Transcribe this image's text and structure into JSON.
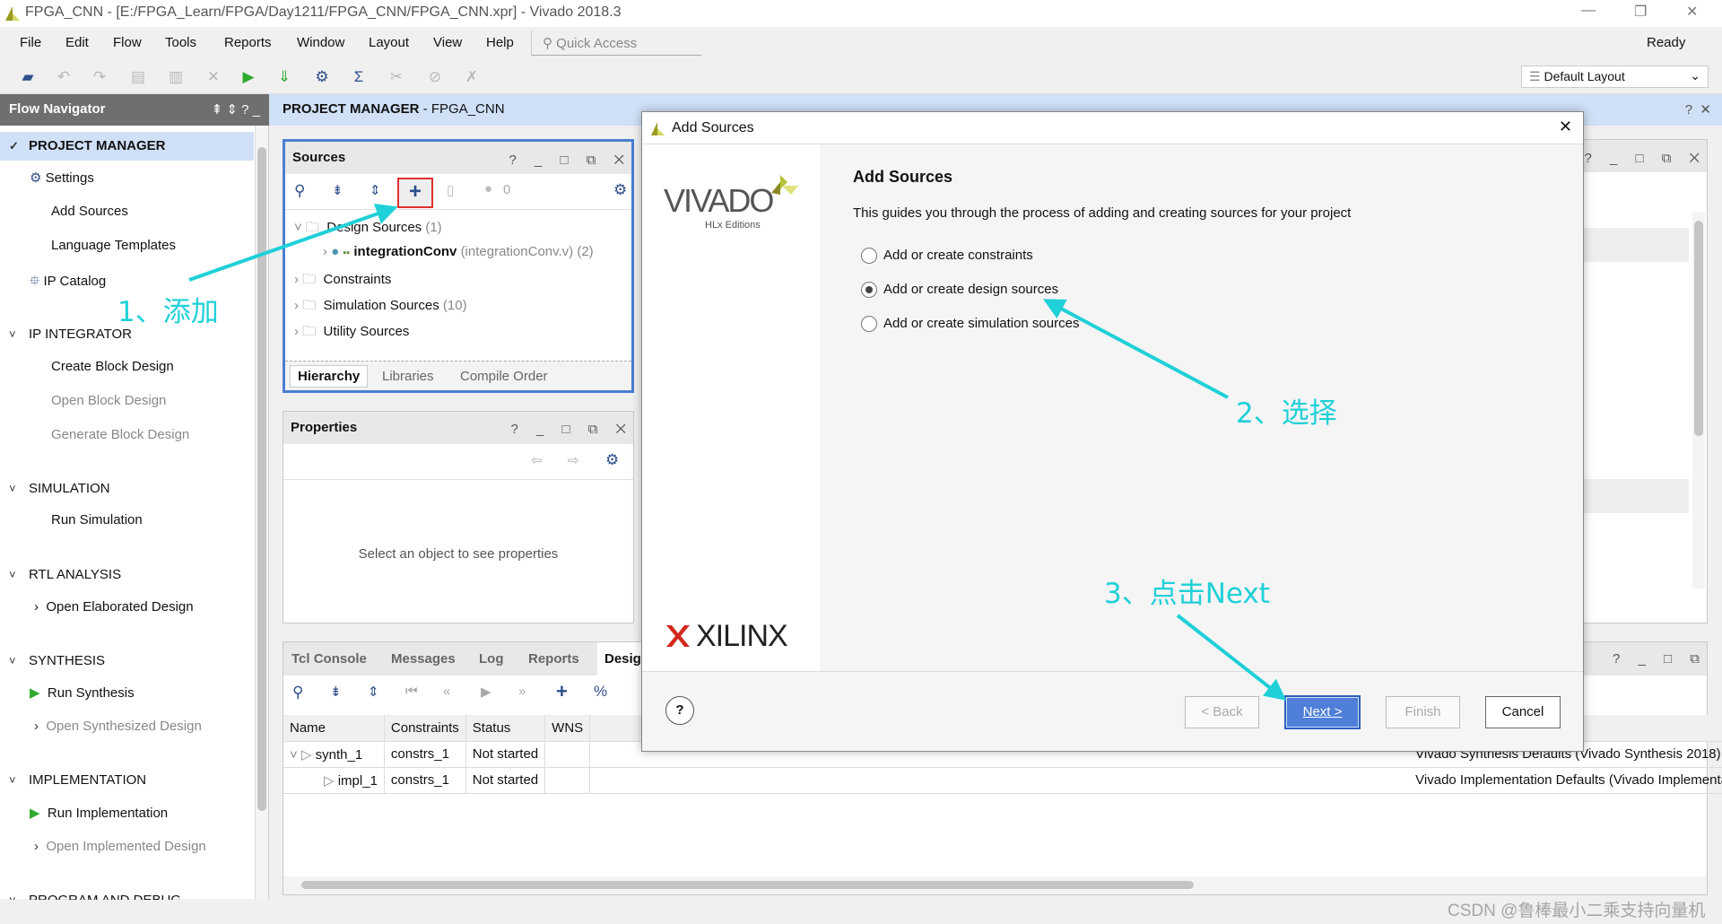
{
  "window": {
    "title": "FPGA_CNN - [E:/FPGA_Learn/FPGA/Day1211/FPGA_CNN/FPGA_CNN.xpr] - Vivado 2018.3",
    "minimize": "—",
    "restore": "❐",
    "close": "✕"
  },
  "menu": [
    "File",
    "Edit",
    "Flow",
    "Tools",
    "Reports",
    "Window",
    "Layout",
    "View",
    "Help"
  ],
  "quick_access": "Quick Access",
  "status": "Ready",
  "layout_select": "Default Layout",
  "toolbar_icons": [
    "open-project-icon",
    "undo-icon",
    "redo-icon",
    "copy-icon",
    "paste-icon",
    "delete-icon",
    "run-icon",
    "program-icon",
    "settings-icon",
    "sigma-icon",
    "cut-icon",
    "disable-icon",
    "x-icon"
  ],
  "flow_nav": {
    "title": "Flow Navigator",
    "controls": "⇞ ⇕ ? _",
    "items": [
      {
        "label": "PROJECT MANAGER",
        "type": "section"
      },
      {
        "label": "Settings",
        "type": "item"
      },
      {
        "label": "Add Sources",
        "type": "item"
      },
      {
        "label": "Language Templates",
        "type": "item"
      },
      {
        "label": "IP Catalog",
        "type": "item"
      },
      {
        "label": "IP INTEGRATOR",
        "type": "section"
      },
      {
        "label": "Create Block Design",
        "type": "item"
      },
      {
        "label": "Open Block Design",
        "type": "disabled"
      },
      {
        "label": "Generate Block Design",
        "type": "disabled"
      },
      {
        "label": "SIMULATION",
        "type": "section"
      },
      {
        "label": "Run Simulation",
        "type": "item"
      },
      {
        "label": "RTL ANALYSIS",
        "type": "section"
      },
      {
        "label": "Open Elaborated Design",
        "type": "item"
      },
      {
        "label": "SYNTHESIS",
        "type": "section"
      },
      {
        "label": "Run Synthesis",
        "type": "item"
      },
      {
        "label": "Open Synthesized Design",
        "type": "disabled"
      },
      {
        "label": "IMPLEMENTATION",
        "type": "section"
      },
      {
        "label": "Run Implementation",
        "type": "item"
      },
      {
        "label": "Open Implemented Design",
        "type": "disabled"
      },
      {
        "label": "PROGRAM AND DEBUG",
        "type": "section"
      }
    ]
  },
  "main_header": {
    "title": "PROJECT MANAGER",
    "project": " - FPGA_CNN"
  },
  "sources": {
    "title": "Sources",
    "controls": "? _ □ ⧉ ✕",
    "error_count": "0",
    "tree": [
      {
        "label": "Design Sources",
        "count": "(1)"
      },
      {
        "label": "integrationConv",
        "detail": "(integrationConv.v) (2)"
      },
      {
        "label": "Constraints",
        "count": ""
      },
      {
        "label": "Simulation Sources",
        "count": "(10)"
      },
      {
        "label": "Utility Sources",
        "count": ""
      }
    ],
    "tabs": [
      "Hierarchy",
      "Libraries",
      "Compile Order"
    ]
  },
  "properties": {
    "title": "Properties",
    "controls": "? _ □ ⧉ ✕",
    "empty": "Select an object to see properties"
  },
  "bottom": {
    "tabs": [
      "Tcl Console",
      "Messages",
      "Log",
      "Reports",
      "Desig"
    ],
    "columns": [
      "Name",
      "Constraints",
      "Status",
      "WNS"
    ],
    "rows": [
      {
        "name": "synth_1",
        "constraints": "constrs_1",
        "status": "Not started",
        "strategy": "Vivado Synthesis Defaults (Vivado Synthesis 2018)"
      },
      {
        "name": "impl_1",
        "constraints": "constrs_1",
        "status": "Not started",
        "strategy": "Vivado Implementation Defaults (Vivado Implementatic"
      }
    ]
  },
  "dialog": {
    "title": "Add Sources",
    "heading": "Add Sources",
    "description": "This guides you through the process of adding and creating sources for your project",
    "options": [
      {
        "label": "Add or create constraints",
        "selected": false
      },
      {
        "label": "Add or create design sources",
        "selected": true
      },
      {
        "label": "Add or create simulation sources",
        "selected": false
      }
    ],
    "logo_vivado": "VIVADO",
    "logo_sub": "HLx Editions",
    "logo_xilinx": "XILINX",
    "buttons": {
      "help": "?",
      "back": "< Back",
      "next": "Next >",
      "finish": "Finish",
      "cancel": "Cancel"
    }
  },
  "annotations": {
    "step1": "1、添加",
    "step2": "2、选择",
    "step3": "3、点击Next",
    "color": "#1fd0d8"
  },
  "watermark": "CSDN @鲁棒最小二乘支持向量机"
}
